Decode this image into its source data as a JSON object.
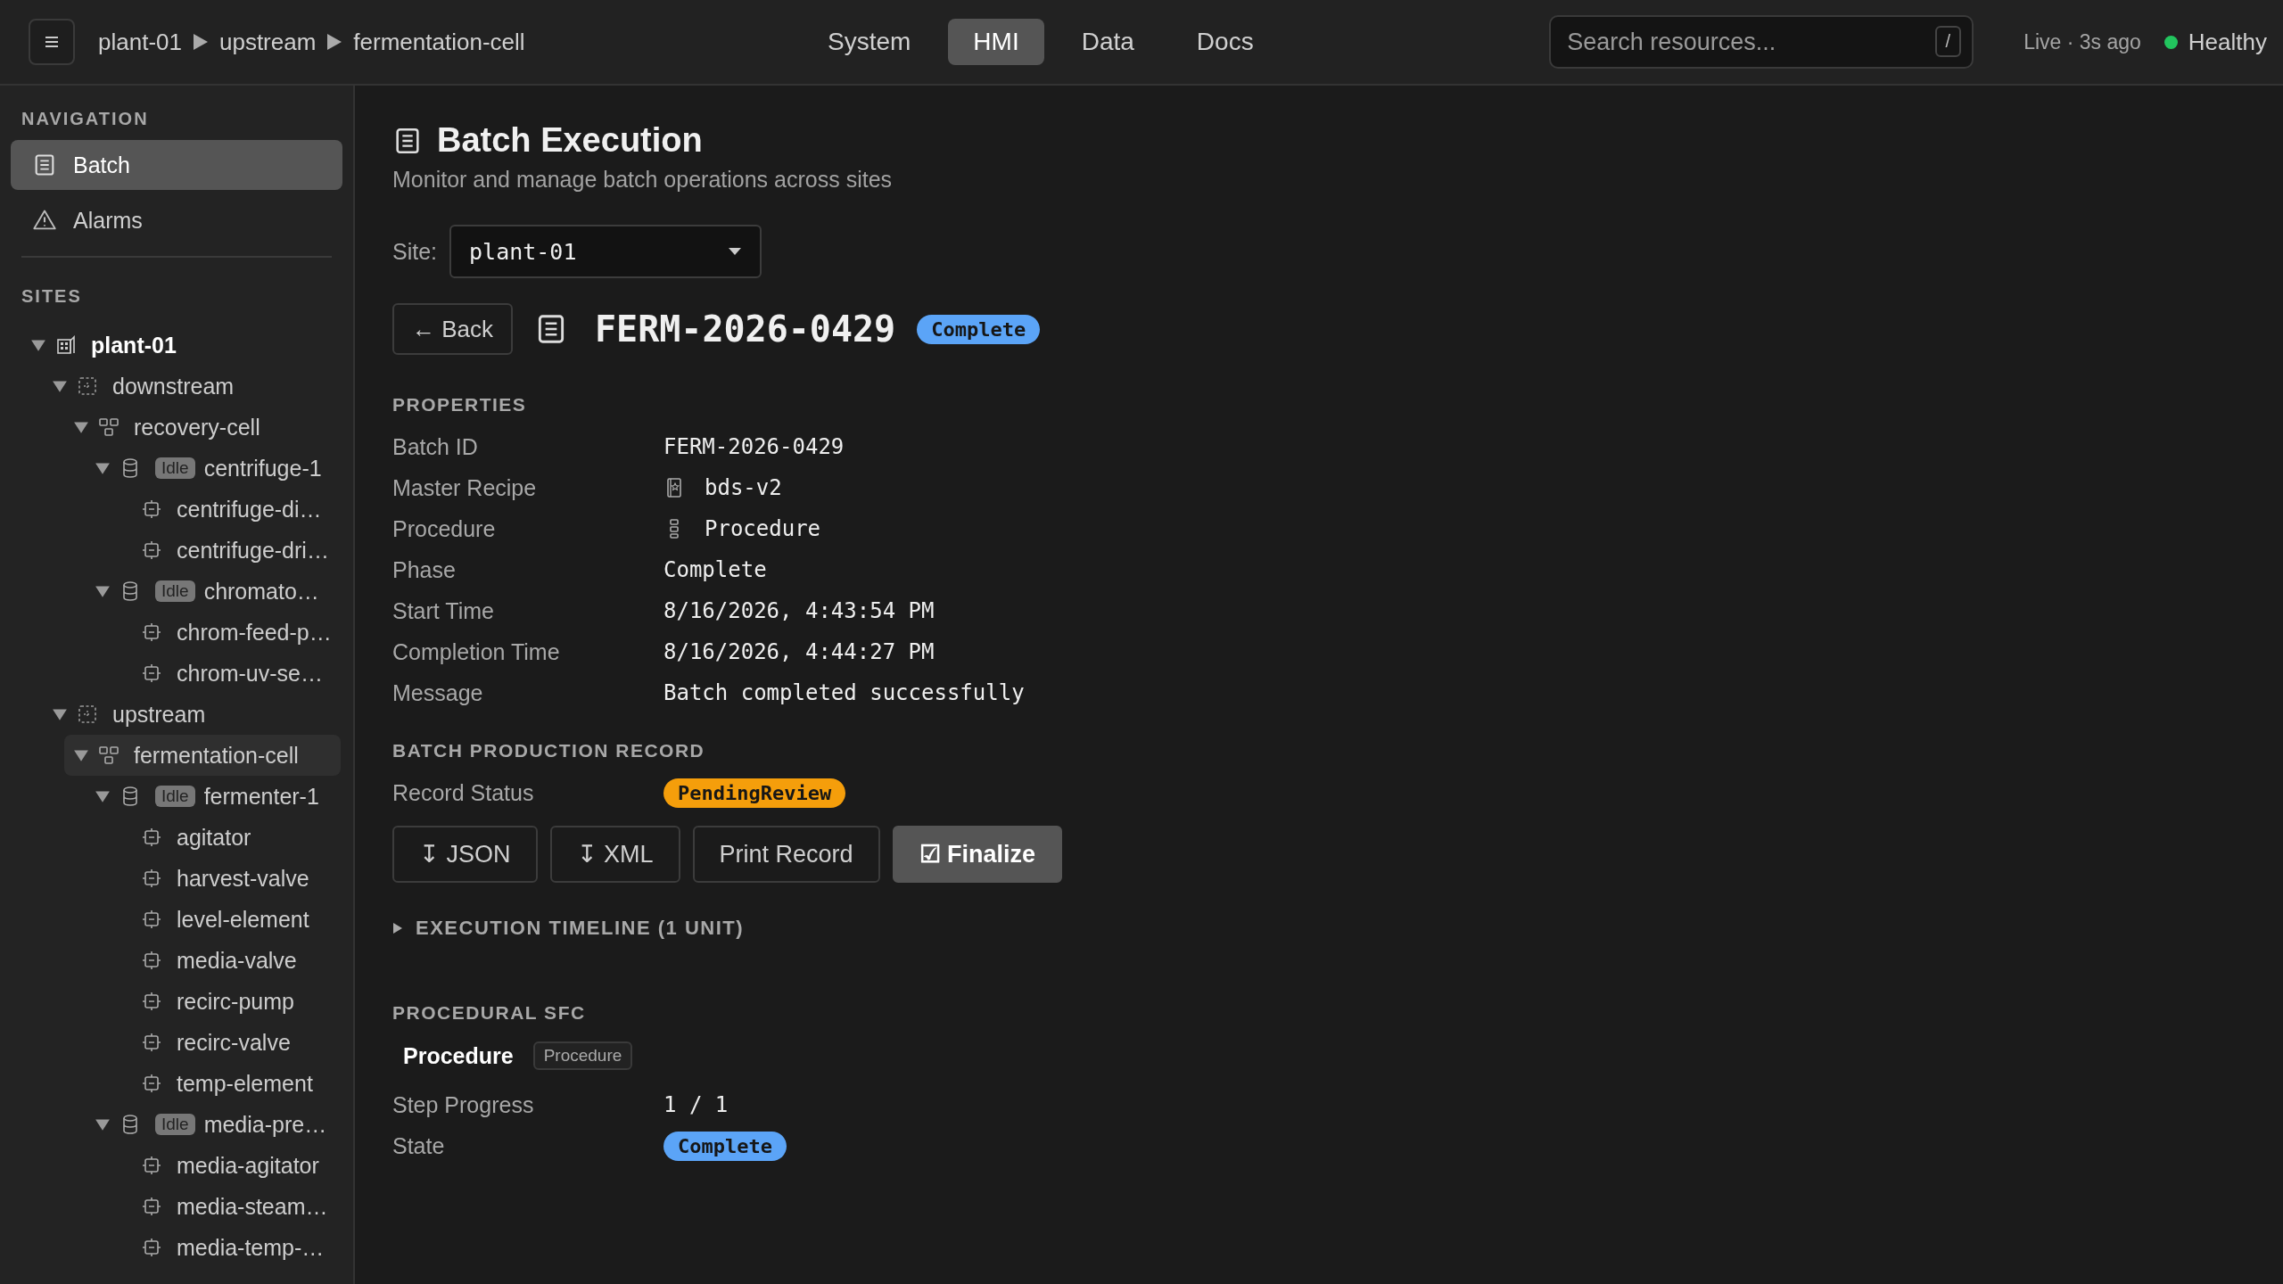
{
  "top_bar": {
    "breadcrumb": [
      "plant-01",
      "upstream",
      "fermentation-cell"
    ],
    "tabs": [
      {
        "label": "System",
        "selected": false
      },
      {
        "label": "HMI",
        "selected": true
      },
      {
        "label": "Data",
        "selected": false
      },
      {
        "label": "Docs",
        "selected": false
      }
    ],
    "search": {
      "placeholder": "Search resources...",
      "shortcut": "/"
    },
    "live": "Live · 3s ago",
    "health": {
      "label": "Healthy",
      "color": "#22c55e"
    }
  },
  "sidebar": {
    "navigation_title": "NAVIGATION",
    "navigation": [
      {
        "label": "Batch",
        "kind": "batch",
        "selected": true
      },
      {
        "label": "Alarms",
        "kind": "alarm",
        "selected": false
      }
    ],
    "sites_title": "SITES",
    "tree": [
      {
        "name": "plant-01",
        "kind": "site",
        "expanded": true,
        "selected": false,
        "children": [
          {
            "name": "downstream",
            "kind": "area",
            "expanded": true,
            "selected": false,
            "children": [
              {
                "name": "recovery-cell",
                "kind": "cell",
                "expanded": true,
                "selected": false,
                "children": [
                  {
                    "name": "centrifuge-1",
                    "kind": "unit",
                    "status": "Idle",
                    "expanded": true,
                    "selected": false,
                    "children": [
                      {
                        "name": "centrifuge-di…",
                        "kind": "module",
                        "selected": false
                      },
                      {
                        "name": "centrifuge-dri…",
                        "kind": "module",
                        "selected": false
                      }
                    ]
                  },
                  {
                    "name": "chromato…",
                    "kind": "unit",
                    "status": "Idle",
                    "expanded": true,
                    "selected": false,
                    "children": [
                      {
                        "name": "chrom-feed-p…",
                        "kind": "module",
                        "selected": false
                      },
                      {
                        "name": "chrom-uv-se…",
                        "kind": "module",
                        "selected": false
                      }
                    ]
                  }
                ]
              }
            ]
          },
          {
            "name": "upstream",
            "kind": "area",
            "expanded": true,
            "selected": false,
            "children": [
              {
                "name": "fermentation-cell",
                "kind": "cell",
                "expanded": true,
                "selected": true,
                "children": [
                  {
                    "name": "fermenter-1",
                    "kind": "unit",
                    "status": "Idle",
                    "expanded": true,
                    "selected": false,
                    "children": [
                      {
                        "name": "agitator",
                        "kind": "module",
                        "selected": false
                      },
                      {
                        "name": "harvest-valve",
                        "kind": "module",
                        "selected": false
                      },
                      {
                        "name": "level-element",
                        "kind": "module",
                        "selected": false
                      },
                      {
                        "name": "media-valve",
                        "kind": "module",
                        "selected": false
                      },
                      {
                        "name": "recirc-pump",
                        "kind": "module",
                        "selected": false
                      },
                      {
                        "name": "recirc-valve",
                        "kind": "module",
                        "selected": false
                      },
                      {
                        "name": "temp-element",
                        "kind": "module",
                        "selected": false
                      }
                    ]
                  },
                  {
                    "name": "media-pre…",
                    "kind": "unit",
                    "status": "Idle",
                    "expanded": true,
                    "selected": false,
                    "children": [
                      {
                        "name": "media-agitator",
                        "kind": "module",
                        "selected": false
                      },
                      {
                        "name": "media-steam…",
                        "kind": "module",
                        "selected": false
                      },
                      {
                        "name": "media-temp-…",
                        "kind": "module",
                        "selected": false
                      }
                    ]
                  }
                ]
              }
            ]
          }
        ]
      }
    ]
  },
  "page": {
    "title": "Batch Execution",
    "subtitle": "Monitor and manage batch operations across sites",
    "site_label": "Site:",
    "site_value": "plant-01",
    "back": "← Back",
    "batch_id": "FERM-2026-0429",
    "batch_status": {
      "text": "Complete",
      "color": "#5ba4f7"
    },
    "properties_title": "PROPERTIES",
    "properties": [
      {
        "label": "Batch ID",
        "value": "FERM-2026-0429",
        "kind": "text"
      },
      {
        "label": "Master Recipe",
        "value": "bds-v2",
        "kind": "recipe"
      },
      {
        "label": "Procedure",
        "value": "Procedure",
        "kind": "procedure"
      },
      {
        "label": "Phase",
        "value": "Complete",
        "kind": "text"
      },
      {
        "label": "Start Time",
        "value": "8/16/2026, 4:43:54 PM",
        "kind": "text"
      },
      {
        "label": "Completion Time",
        "value": "8/16/2026, 4:44:27 PM",
        "kind": "text"
      },
      {
        "label": "Message",
        "value": "Batch completed successfully",
        "kind": "text"
      }
    ],
    "record_title": "BATCH PRODUCTION RECORD",
    "record_status_label": "Record Status",
    "record_status": {
      "text": "PendingReview",
      "color": "#f59e0b"
    },
    "actions": [
      {
        "label": "↧ JSON",
        "kind": "outline"
      },
      {
        "label": "↧ XML",
        "kind": "outline"
      },
      {
        "label": "Print Record",
        "kind": "outline"
      },
      {
        "label": "☑ Finalize",
        "kind": "primary"
      }
    ],
    "timeline": {
      "label": "EXECUTION TIMELINE (1 UNIT)",
      "expanded": false
    },
    "sfc_title": "PROCEDURAL SFC",
    "sfc": {
      "name": "Procedure",
      "tag": "Procedure",
      "rows": [
        {
          "label": "Step Progress",
          "value": "1 / 1",
          "kind": "text"
        },
        {
          "label": "State",
          "value": "Complete",
          "kind": "badge",
          "color": "#5ba4f7"
        }
      ]
    }
  }
}
